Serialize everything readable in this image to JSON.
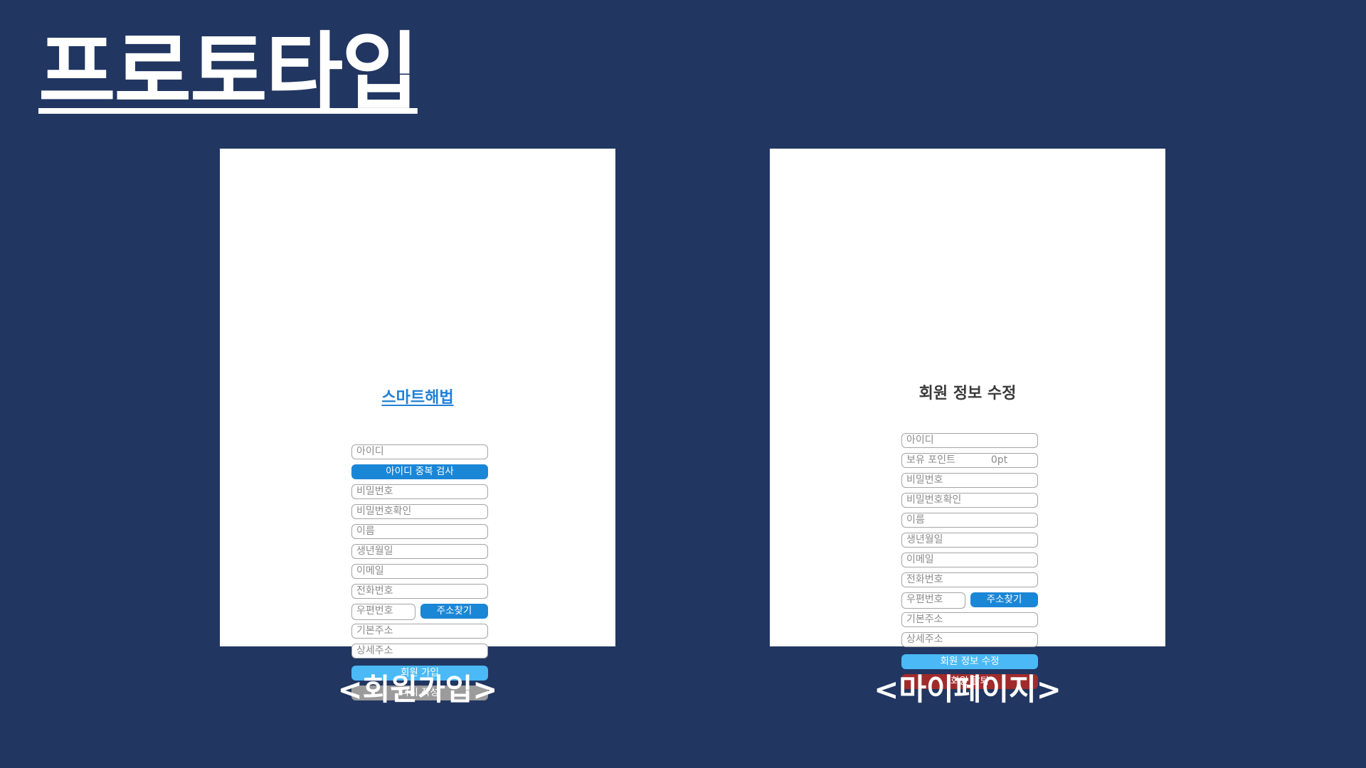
{
  "page": {
    "title": "프로토타입"
  },
  "signup": {
    "caption": "<회원가입>",
    "logo": "스마트해법",
    "fields": {
      "id": "아이디",
      "password": "비밀번호",
      "password_confirm": "비밀번호확인",
      "name": "이름",
      "birthdate": "생년월일",
      "email": "이메일",
      "phone": "전화번호",
      "zipcode": "우편번호",
      "address": "기본주소",
      "address_detail": "상세주소"
    },
    "buttons": {
      "check_id": "아이디 중복 검사",
      "find_address": "주소찾기",
      "submit": "회원 가입",
      "reset": "다시 작성"
    }
  },
  "mypage": {
    "caption": "<마이페이지>",
    "heading": "회원 정보 수정",
    "fields": {
      "id": "아이디",
      "points_label": "보유 포인트",
      "points_value": "0pt",
      "password": "비밀번호",
      "password_confirm": "비밀번호확인",
      "name": "이름",
      "birthdate": "생년월일",
      "email": "이메일",
      "phone": "전화번호",
      "zipcode": "우편번호",
      "address": "기본주소",
      "address_detail": "상세주소"
    },
    "buttons": {
      "find_address": "주소찾기",
      "update": "회원 정보 수정",
      "withdraw": "회원 탈퇴"
    }
  },
  "colors": {
    "background": "#213661",
    "primary_blue": "#1a86d6",
    "sky_blue": "#4ab9f5",
    "gray": "#9b9b9b",
    "danger_red": "#a12b2b",
    "logo_blue": "#1f7fd6"
  }
}
